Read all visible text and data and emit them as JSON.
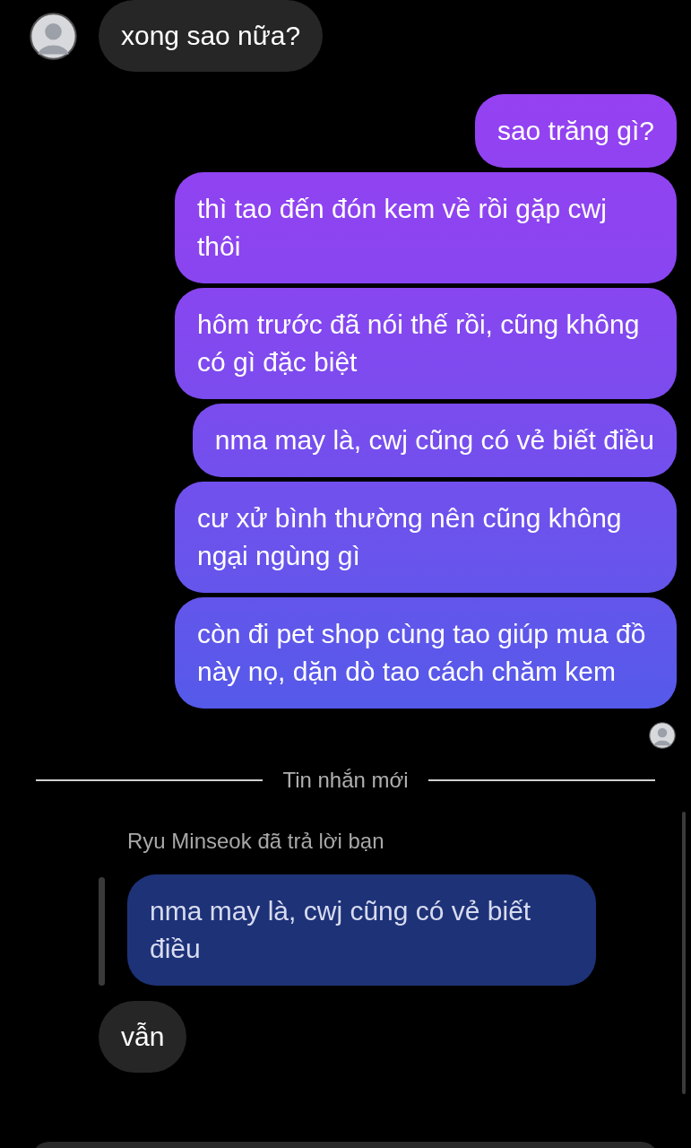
{
  "messages": [
    {
      "kind": "incoming",
      "text": "xong sao nữa?"
    },
    {
      "kind": "outgoing",
      "text": "sao trăng gì?"
    },
    {
      "kind": "outgoing",
      "text": "thì tao đến đón kem về rồi gặp cwj thôi"
    },
    {
      "kind": "outgoing",
      "text": "hôm trước đã nói thế rồi, cũng không có gì đặc biệt"
    },
    {
      "kind": "outgoing",
      "text": "nma may là, cwj cũng có vẻ biết điều"
    },
    {
      "kind": "outgoing",
      "text": "cư xử bình thường nên cũng không ngại ngùng gì"
    },
    {
      "kind": "outgoing",
      "text": "còn đi pet shop cùng tao giúp mua đồ này nọ, dặn dò tao cách chăm kem"
    },
    {
      "kind": "seen"
    },
    {
      "kind": "divider",
      "text": "Tin nhắn mới"
    },
    {
      "kind": "reply",
      "label": "Ryu Minseok đã trả lời bạn",
      "text": "nma may là, cwj cũng có vẻ biết điều"
    },
    {
      "kind": "incoming",
      "text": "vẫn"
    }
  ]
}
